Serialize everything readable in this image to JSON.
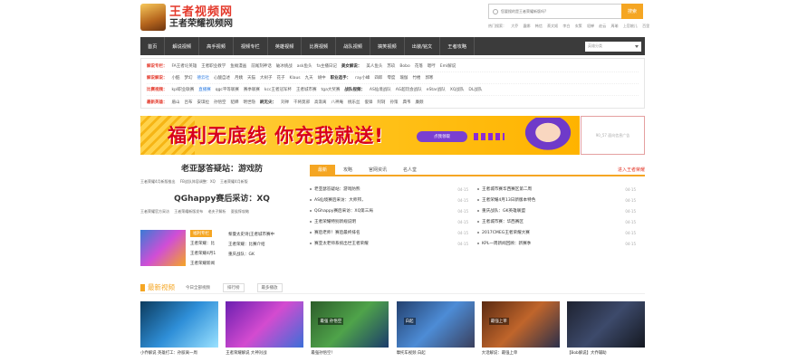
{
  "header": {
    "logo_title": "王者视频网",
    "logo_subtitle": "王者荣耀视频网",
    "search_placeholder": "您要搜的是王者荣耀新版吗?",
    "search_button": "搜索",
    "hotwords": [
      "热门搜索：",
      "大乔",
      "露娜",
      "韩信",
      "蔡文姬",
      "李白",
      "玄策",
      "貂蝉",
      "赵云",
      "周瑜",
      "上官婉儿",
      "百里"
    ]
  },
  "nav": {
    "items": [
      "首页",
      "解说视频",
      "高手视频",
      "视频专栏",
      "英雄视频",
      "比赛视频",
      "战队视频",
      "搞笑视频",
      "出装/铭文",
      "王者攻略"
    ],
    "select_placeholder": "英雄分类"
  },
  "categories": [
    {
      "label": "解说专栏：",
      "items": [
        "FA王者论英雄",
        "王者职业教学",
        "鱼摊漫画",
        "前尾刻神话",
        "破冰挑战",
        "ask鱼头",
        "fa主播日记"
      ],
      "sub_label": "美女解说：",
      "sub_items": [
        "美人鱼头",
        "苏玖",
        "Bobo",
        "花落",
        "嗯哼",
        "Emi解说"
      ]
    },
    {
      "label": "解说解说：",
      "items": [
        "小酷",
        "梦幻",
        "德云社",
        "心酸自述",
        "月姨",
        "天猫",
        "大树子",
        "花子",
        "Klaus",
        "九天",
        "胡中"
      ],
      "sub_label": "职业选手：",
      "sub_items": [
        "ray小峰",
        "四郎",
        "零度",
        "瑜伽",
        "竹楼",
        "郭寒"
      ]
    },
    {
      "label": "比赛视频：",
      "items": [
        "kpl职业联赛",
        "直播赛",
        "qgc平等联赛",
        "赛季联赛",
        "kcc王者冠军杯",
        "王者城市赛",
        "tga大奖赛"
      ],
      "sub_label": "战队视频：",
      "sub_items": [
        "AS仙境战队",
        "AG超玩会战队",
        "eStar战队",
        "XQ战队",
        "DL战队"
      ]
    },
    {
      "label": "最新英雄：",
      "items": [
        "盾山",
        "吕布",
        "安琪拉",
        "孙悟空",
        "貂蝉",
        "明世隐"
      ],
      "sub_label": "刷无尖：",
      "sub_items": [
        "刘禅",
        "干将莫邪",
        "高渐离",
        "八神庵",
        "桃乐丝",
        "俊锋",
        "阿轲",
        "孙策",
        "典韦",
        "廉颇"
      ]
    }
  ],
  "banner": {
    "text": "福利无底线 你充我就送!",
    "button": "点我领取"
  },
  "side_ad": "90_57 面向信息广告",
  "left": {
    "headline": "老亚瑟答疑站：游戏防",
    "headline_links": [
      "王者荣耀4月新版推出",
      "FB战队阵容调整：XQ",
      "王者荣耀4月新版"
    ],
    "headline2": "QGhappy赛后采访：XQ",
    "headline2_links": [
      "王者荣耀官方采访",
      "王者荣耀新版发布",
      "老夫子解析",
      "夏侯惇攻略"
    ],
    "feature_tag": "福利专栏",
    "feature_list": [
      "王者荣耀：比",
      "王者荣耀4月1",
      "王者荣耀新闻"
    ],
    "feature_right": [
      "黎曼太史诗|王者城市赛中",
      "王者荣耀：比赛介绍",
      "重庆战队：GK"
    ]
  },
  "news": {
    "tabs": [
      "最新",
      "攻略",
      "官网资讯",
      "名人堂"
    ],
    "more": "进入王者荣耀",
    "left_items": [
      {
        "t": "老亚瑟答疑站：游戏防熊",
        "d": "04-15"
      },
      {
        "t": "AS仙境赛后采访：大师邦，",
        "d": "04-15"
      },
      {
        "t": "QGhappy赛后采访：XQ第三局",
        "d": "04-15"
      },
      {
        "t": "王者荣耀特别新规说明",
        "d": "04-15"
      },
      {
        "t": "赛后老师！赛后最终排名",
        "d": "04-15"
      },
      {
        "t": "赛亚太老师系统出世王者荣耀",
        "d": "04-15"
      }
    ],
    "right_items": [
      {
        "t": "王者城市赛华西赛区第二周",
        "d": "04-15"
      },
      {
        "t": "王者荣耀4月13日新版本特色",
        "d": "04-15"
      },
      {
        "t": "重庆战队：GK英雄联盟",
        "d": "04-15"
      },
      {
        "t": "王者城市赛：华西赛区",
        "d": "04-15"
      },
      {
        "t": "2017CMEG王者荣耀大赛",
        "d": "04-15"
      },
      {
        "t": "KPL一周新闻回顾：新赛季",
        "d": "04-15"
      }
    ]
  },
  "videos": {
    "title": "最新视频",
    "tabs": [
      "今日全部视频",
      "排行榜",
      "最多播放"
    ],
    "items": [
      {
        "caption": "小乔解说 英雄打工：孙膑离一周",
        "overlay": ""
      },
      {
        "caption": "王者荣耀解说 大神对战",
        "overlay": ""
      },
      {
        "caption": "最强孙悟空！",
        "overlay": "最强 孙悟空"
      },
      {
        "caption": "摩托车视频 白起",
        "overlay": "白起"
      },
      {
        "caption": "大话解说：最强上单",
        "overlay": "最强上单"
      },
      {
        "caption": "【Bob解说】大乔辅助",
        "overlay": ""
      }
    ]
  },
  "colors": {
    "accent": "#f5a623",
    "brand_red": "#e4392b",
    "nav_bg": "#3b3b3b"
  }
}
